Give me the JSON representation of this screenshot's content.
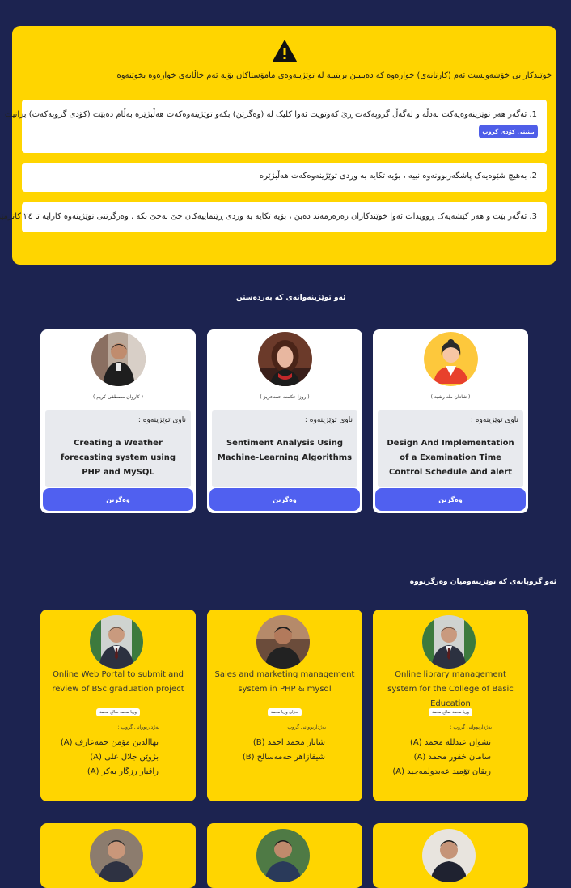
{
  "notice": {
    "intro": "خوێندکارانی خۆشەویست ئەم (کارتانەی) خوارەوە کە دەیبینن بریتییە لە توێژینەوەی مامۆستاکان بۆیە ئەم خاڵانەی خوارەوە بخوێنەوە",
    "rules": [
      "1. ئەگەر هەر توێژینەوەیەکت بەدڵە و لەگەڵ گروپەکەت ڕێ کەوتویت ئەوا کلیک لە (وەگرتن) بکەو توێژینەوەکەت هەڵبژێرە بەڵام دەبێت (کۆدی گروپەکەت) بزانیت",
      "2. بەهیچ شێوەیەک پاشگەزبوونەوە نییە ، بۆیە تکایە بە وردی توێژینەوەکەت هەڵبژێرە",
      "3. ئەگەر بێت و هەر کێشەیەک ڕوویدات ئەوا خوێندکاران زەرەرمەند دەبن ، بۆیە تکایە بە وردی ڕێنماییەکان جێ بەجێ بکە , وەرگرتنی توێژینەوە کارایە تا ٢٤ کاتژمێر"
    ],
    "group_code_button": "بینینی کۆدی گروپ"
  },
  "available": {
    "title": "ئەو توێژینەوانەی کە بەردەستن",
    "label": "ناوی توێژینەوە :",
    "button": "وەگرتن",
    "cards": [
      {
        "supervisor": "( شادان طه رشيد )",
        "title": "Design And Implementation of a Examination Time Control Schedule And alert"
      },
      {
        "supervisor": "( روزا حكمت حمەعزيز )",
        "title": "Sentiment Analysis Using Machine-Learning Algorithms"
      },
      {
        "supervisor": "( كاروان مصطفى كريم )",
        "title": "Creating a Weather forecasting system using PHP and MySQL"
      }
    ]
  },
  "taken": {
    "title": "ئەو گروپانەی کە توێژینەومیان وەرگرتووە",
    "members_label": "بەژداربووانی گروپ :",
    "cards": [
      {
        "title": "Online library management system for the College of Basic Education",
        "supervisor": "وريا محمد صالح محمد",
        "members": [
          "نشوان عبدللە محمد (A)",
          "سامان خفور محمد (A)",
          "ريقان تۆميد عەبدولمەجيد (A)"
        ]
      },
      {
        "title": "Sales and marketing management system in PHP & mysql",
        "supervisor": "لەزای وريا محمد",
        "members": [
          "شاناز محمد احمد (B)",
          "شیفازاهر حەمەسالح (B)"
        ]
      },
      {
        "title": "Online Web Portal to submit and review of BSc graduation project",
        "supervisor": "وريا محمد صالح محمد",
        "members": [
          "بهاالدين مؤمن حمەعارف (A)",
          "بژوێن جلال علی (A)",
          "راقيار رزگار بەکر (A)"
        ]
      }
    ]
  },
  "colors": {
    "background": "#1c2350",
    "accent_yellow": "#ffd500",
    "button_blue": "#5060f0"
  }
}
